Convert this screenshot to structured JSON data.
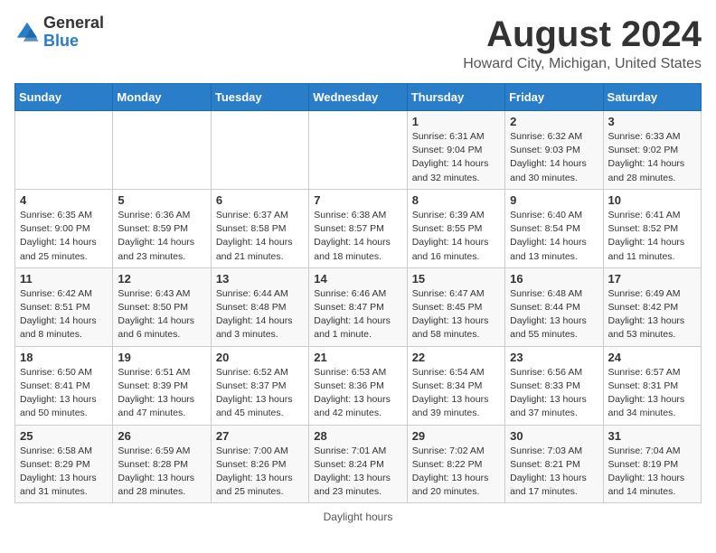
{
  "logo": {
    "general": "General",
    "blue": "Blue"
  },
  "title": "August 2024",
  "subtitle": "Howard City, Michigan, United States",
  "footer": "Daylight hours",
  "days_header": [
    "Sunday",
    "Monday",
    "Tuesday",
    "Wednesday",
    "Thursday",
    "Friday",
    "Saturday"
  ],
  "weeks": [
    [
      {
        "day": "",
        "info": ""
      },
      {
        "day": "",
        "info": ""
      },
      {
        "day": "",
        "info": ""
      },
      {
        "day": "",
        "info": ""
      },
      {
        "day": "1",
        "info": "Sunrise: 6:31 AM\nSunset: 9:04 PM\nDaylight: 14 hours\nand 32 minutes."
      },
      {
        "day": "2",
        "info": "Sunrise: 6:32 AM\nSunset: 9:03 PM\nDaylight: 14 hours\nand 30 minutes."
      },
      {
        "day": "3",
        "info": "Sunrise: 6:33 AM\nSunset: 9:02 PM\nDaylight: 14 hours\nand 28 minutes."
      }
    ],
    [
      {
        "day": "4",
        "info": "Sunrise: 6:35 AM\nSunset: 9:00 PM\nDaylight: 14 hours\nand 25 minutes."
      },
      {
        "day": "5",
        "info": "Sunrise: 6:36 AM\nSunset: 8:59 PM\nDaylight: 14 hours\nand 23 minutes."
      },
      {
        "day": "6",
        "info": "Sunrise: 6:37 AM\nSunset: 8:58 PM\nDaylight: 14 hours\nand 21 minutes."
      },
      {
        "day": "7",
        "info": "Sunrise: 6:38 AM\nSunset: 8:57 PM\nDaylight: 14 hours\nand 18 minutes."
      },
      {
        "day": "8",
        "info": "Sunrise: 6:39 AM\nSunset: 8:55 PM\nDaylight: 14 hours\nand 16 minutes."
      },
      {
        "day": "9",
        "info": "Sunrise: 6:40 AM\nSunset: 8:54 PM\nDaylight: 14 hours\nand 13 minutes."
      },
      {
        "day": "10",
        "info": "Sunrise: 6:41 AM\nSunset: 8:52 PM\nDaylight: 14 hours\nand 11 minutes."
      }
    ],
    [
      {
        "day": "11",
        "info": "Sunrise: 6:42 AM\nSunset: 8:51 PM\nDaylight: 14 hours\nand 8 minutes."
      },
      {
        "day": "12",
        "info": "Sunrise: 6:43 AM\nSunset: 8:50 PM\nDaylight: 14 hours\nand 6 minutes."
      },
      {
        "day": "13",
        "info": "Sunrise: 6:44 AM\nSunset: 8:48 PM\nDaylight: 14 hours\nand 3 minutes."
      },
      {
        "day": "14",
        "info": "Sunrise: 6:46 AM\nSunset: 8:47 PM\nDaylight: 14 hours\nand 1 minute."
      },
      {
        "day": "15",
        "info": "Sunrise: 6:47 AM\nSunset: 8:45 PM\nDaylight: 13 hours\nand 58 minutes."
      },
      {
        "day": "16",
        "info": "Sunrise: 6:48 AM\nSunset: 8:44 PM\nDaylight: 13 hours\nand 55 minutes."
      },
      {
        "day": "17",
        "info": "Sunrise: 6:49 AM\nSunset: 8:42 PM\nDaylight: 13 hours\nand 53 minutes."
      }
    ],
    [
      {
        "day": "18",
        "info": "Sunrise: 6:50 AM\nSunset: 8:41 PM\nDaylight: 13 hours\nand 50 minutes."
      },
      {
        "day": "19",
        "info": "Sunrise: 6:51 AM\nSunset: 8:39 PM\nDaylight: 13 hours\nand 47 minutes."
      },
      {
        "day": "20",
        "info": "Sunrise: 6:52 AM\nSunset: 8:37 PM\nDaylight: 13 hours\nand 45 minutes."
      },
      {
        "day": "21",
        "info": "Sunrise: 6:53 AM\nSunset: 8:36 PM\nDaylight: 13 hours\nand 42 minutes."
      },
      {
        "day": "22",
        "info": "Sunrise: 6:54 AM\nSunset: 8:34 PM\nDaylight: 13 hours\nand 39 minutes."
      },
      {
        "day": "23",
        "info": "Sunrise: 6:56 AM\nSunset: 8:33 PM\nDaylight: 13 hours\nand 37 minutes."
      },
      {
        "day": "24",
        "info": "Sunrise: 6:57 AM\nSunset: 8:31 PM\nDaylight: 13 hours\nand 34 minutes."
      }
    ],
    [
      {
        "day": "25",
        "info": "Sunrise: 6:58 AM\nSunset: 8:29 PM\nDaylight: 13 hours\nand 31 minutes."
      },
      {
        "day": "26",
        "info": "Sunrise: 6:59 AM\nSunset: 8:28 PM\nDaylight: 13 hours\nand 28 minutes."
      },
      {
        "day": "27",
        "info": "Sunrise: 7:00 AM\nSunset: 8:26 PM\nDaylight: 13 hours\nand 25 minutes."
      },
      {
        "day": "28",
        "info": "Sunrise: 7:01 AM\nSunset: 8:24 PM\nDaylight: 13 hours\nand 23 minutes."
      },
      {
        "day": "29",
        "info": "Sunrise: 7:02 AM\nSunset: 8:22 PM\nDaylight: 13 hours\nand 20 minutes."
      },
      {
        "day": "30",
        "info": "Sunrise: 7:03 AM\nSunset: 8:21 PM\nDaylight: 13 hours\nand 17 minutes."
      },
      {
        "day": "31",
        "info": "Sunrise: 7:04 AM\nSunset: 8:19 PM\nDaylight: 13 hours\nand 14 minutes."
      }
    ]
  ]
}
